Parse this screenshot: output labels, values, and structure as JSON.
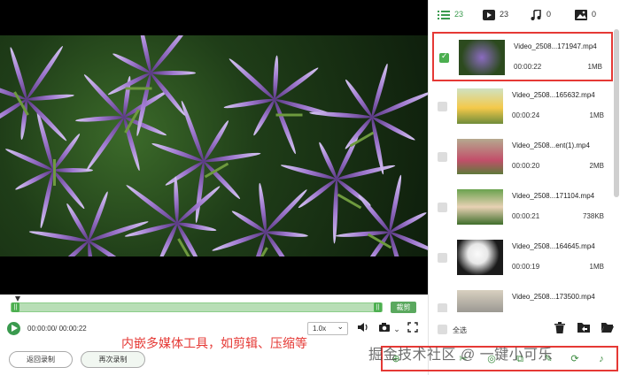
{
  "tabs": [
    {
      "icon": "list-icon",
      "count": "23"
    },
    {
      "icon": "video-icon",
      "count": "23"
    },
    {
      "icon": "music-icon",
      "count": "0"
    },
    {
      "icon": "image-icon",
      "count": "0"
    }
  ],
  "files": [
    {
      "name": "Video_2508...171947.mp4",
      "duration": "00:00:22",
      "size": "1MB",
      "checked": true
    },
    {
      "name": "Video_2508...165632.mp4",
      "duration": "00:00:24",
      "size": "1MB",
      "checked": false
    },
    {
      "name": "Video_2508...ent(1).mp4",
      "duration": "00:00:20",
      "size": "2MB",
      "checked": false
    },
    {
      "name": "Video_2508...171104.mp4",
      "duration": "00:00:21",
      "size": "738KB",
      "checked": false
    },
    {
      "name": "Video_2508...164645.mp4",
      "duration": "00:00:19",
      "size": "1MB",
      "checked": false
    },
    {
      "name": "Video_2508...173500.mp4",
      "duration": "",
      "size": "",
      "checked": false
    }
  ],
  "timeline": {
    "clip_label": "裁剪",
    "left_handle": "||",
    "right_handle": "||"
  },
  "controls": {
    "time": "00:00:00/ 00:00:22",
    "speed": "1.0x"
  },
  "bottom": {
    "back_label": "返回录制",
    "record_again_label": "再次录制"
  },
  "caption": "内嵌多媒体工具，如剪辑、压缩等",
  "list_footer": {
    "select_all": "全选"
  },
  "watermark": "掘金技术社区 @ 一键小可乐",
  "colors": {
    "accent": "#4caf50",
    "highlight": "#e53935"
  }
}
